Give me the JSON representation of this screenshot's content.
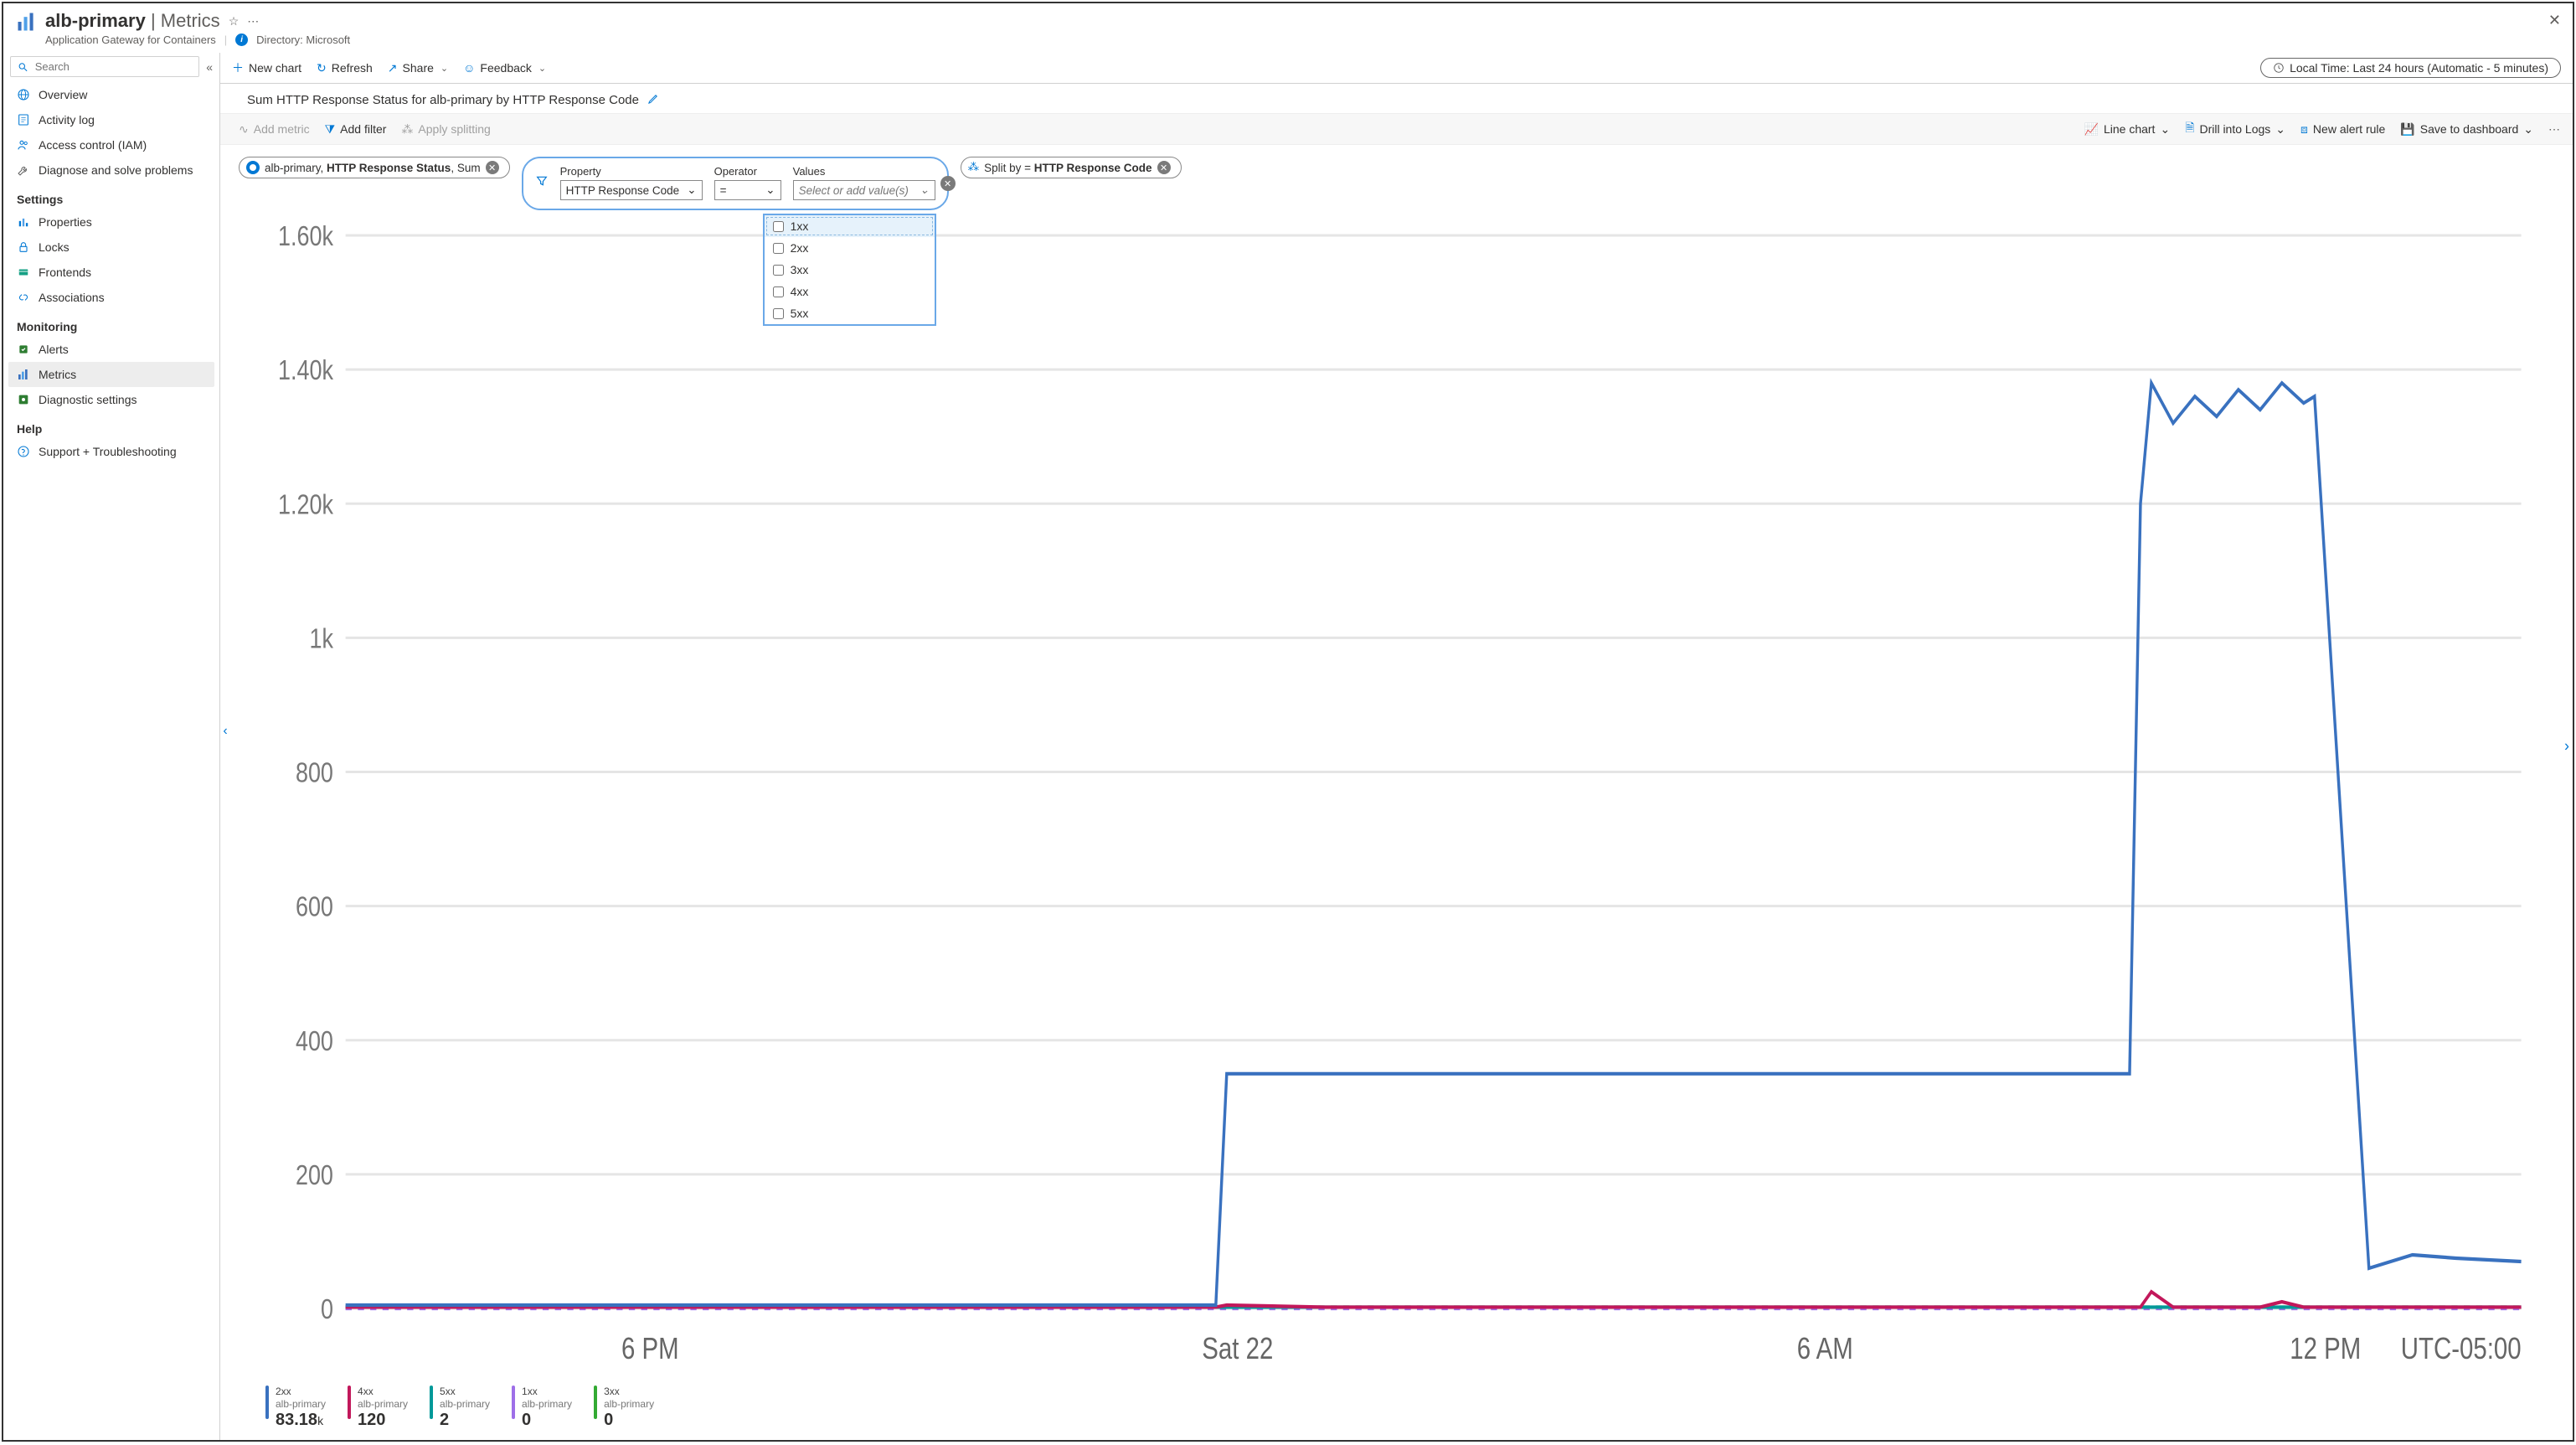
{
  "header": {
    "resource": "alb-primary",
    "page": "Metrics",
    "subtitle": "Application Gateway for Containers",
    "directory_label": "Directory:",
    "directory_value": "Microsoft"
  },
  "sidebar": {
    "search_placeholder": "Search",
    "groups": [
      {
        "heading": null,
        "items": [
          {
            "id": "overview",
            "label": "Overview",
            "icon": "globe"
          },
          {
            "id": "activity",
            "label": "Activity log",
            "icon": "log"
          },
          {
            "id": "iam",
            "label": "Access control (IAM)",
            "icon": "people"
          },
          {
            "id": "diag",
            "label": "Diagnose and solve problems",
            "icon": "wrench"
          }
        ]
      },
      {
        "heading": "Settings",
        "items": [
          {
            "id": "properties",
            "label": "Properties",
            "icon": "props"
          },
          {
            "id": "locks",
            "label": "Locks",
            "icon": "lock"
          },
          {
            "id": "frontends",
            "label": "Frontends",
            "icon": "card"
          },
          {
            "id": "associations",
            "label": "Associations",
            "icon": "link"
          }
        ]
      },
      {
        "heading": "Monitoring",
        "items": [
          {
            "id": "alerts",
            "label": "Alerts",
            "icon": "alert"
          },
          {
            "id": "metrics",
            "label": "Metrics",
            "icon": "metrics",
            "active": true
          },
          {
            "id": "diagset",
            "label": "Diagnostic settings",
            "icon": "diagset"
          }
        ]
      },
      {
        "heading": "Help",
        "items": [
          {
            "id": "support",
            "label": "Support + Troubleshooting",
            "icon": "help"
          }
        ]
      }
    ]
  },
  "toolbar": {
    "new_chart": "New chart",
    "refresh": "Refresh",
    "share": "Share",
    "feedback": "Feedback",
    "time_range": "Local Time: Last 24 hours (Automatic - 5 minutes)"
  },
  "chart": {
    "title": "Sum HTTP Response Status for alb-primary by HTTP Response Code",
    "toolbar": {
      "add_metric": "Add metric",
      "add_filter": "Add filter",
      "apply_splitting": "Apply splitting",
      "line_chart": "Line chart",
      "drill_logs": "Drill into Logs",
      "new_alert": "New alert rule",
      "save_dashboard": "Save to dashboard"
    },
    "metric_pill": {
      "resource": "alb-primary",
      "metric": "HTTP Response Status",
      "agg": "Sum"
    },
    "split_pill": {
      "prefix": "Split by =",
      "value": "HTTP Response Code"
    },
    "filter": {
      "property_label": "Property",
      "property_value": "HTTP Response Code",
      "operator_label": "Operator",
      "operator_value": "=",
      "values_label": "Values",
      "values_placeholder": "Select or add value(s)",
      "options": [
        "1xx",
        "2xx",
        "3xx",
        "4xx",
        "5xx"
      ]
    }
  },
  "chart_data": {
    "type": "line",
    "ylabel": "",
    "ylim": [
      0,
      1600
    ],
    "y_ticks": [
      "0",
      "200",
      "400",
      "600",
      "800",
      "1k",
      "1.20k",
      "1.40k",
      "1.60k"
    ],
    "x_ticks": [
      "6 PM",
      "Sat 22",
      "6 AM",
      "12 PM"
    ],
    "tz_label": "UTC-05:00",
    "x": [
      0,
      0.05,
      0.1,
      0.15,
      0.2,
      0.25,
      0.3,
      0.35,
      0.4,
      0.405,
      0.45,
      0.5,
      0.55,
      0.6,
      0.65,
      0.7,
      0.75,
      0.8,
      0.82,
      0.825,
      0.83,
      0.84,
      0.85,
      0.86,
      0.87,
      0.88,
      0.89,
      0.9,
      0.905,
      0.93,
      0.95,
      0.97,
      1.0
    ],
    "series": [
      {
        "name": "2xx",
        "color": "#3971bf",
        "values": [
          5,
          5,
          5,
          5,
          5,
          5,
          5,
          5,
          5,
          350,
          350,
          350,
          350,
          350,
          350,
          350,
          350,
          350,
          350,
          1200,
          1380,
          1320,
          1360,
          1330,
          1370,
          1340,
          1380,
          1350,
          1360,
          60,
          80,
          75,
          70
        ]
      },
      {
        "name": "4xx",
        "color": "#c2185b",
        "values": [
          2,
          2,
          2,
          2,
          2,
          2,
          2,
          2,
          2,
          5,
          2,
          2,
          2,
          2,
          2,
          2,
          2,
          2,
          2,
          2,
          25,
          2,
          2,
          2,
          2,
          2,
          10,
          2,
          2,
          2,
          2,
          2,
          2
        ]
      },
      {
        "name": "5xx",
        "color": "#009999",
        "values": [
          2,
          2,
          2,
          2,
          2,
          2,
          2,
          2,
          2,
          2,
          2,
          2,
          2,
          2,
          2,
          2,
          2,
          2,
          2,
          2,
          2,
          2,
          2,
          2,
          2,
          2,
          2,
          2,
          2,
          2,
          2,
          2,
          2
        ]
      },
      {
        "name": "1xx",
        "color": "#9e6fe8",
        "values": [
          0,
          0,
          0,
          0,
          0,
          0,
          0,
          0,
          0,
          0,
          0,
          0,
          0,
          0,
          0,
          0,
          0,
          0,
          0,
          0,
          0,
          0,
          0,
          0,
          0,
          0,
          0,
          0,
          0,
          0,
          0,
          0,
          0
        ]
      },
      {
        "name": "3xx",
        "color": "#33aa33",
        "values": [
          2,
          2,
          2,
          2,
          2,
          2,
          2,
          2,
          2,
          2,
          2,
          2,
          2,
          2,
          2,
          2,
          2,
          2,
          2,
          2,
          2,
          2,
          2,
          2,
          2,
          2,
          2,
          2,
          2,
          2,
          2,
          2,
          2
        ]
      }
    ]
  },
  "legend": [
    {
      "code": "2xx",
      "resource": "alb-primary",
      "value": "83.18",
      "unit": "k",
      "color": "#3971bf"
    },
    {
      "code": "4xx",
      "resource": "alb-primary",
      "value": "120",
      "unit": "",
      "color": "#c2185b"
    },
    {
      "code": "5xx",
      "resource": "alb-primary",
      "value": "2",
      "unit": "",
      "color": "#009999"
    },
    {
      "code": "1xx",
      "resource": "alb-primary",
      "value": "0",
      "unit": "",
      "color": "#9e6fe8"
    },
    {
      "code": "3xx",
      "resource": "alb-primary",
      "value": "0",
      "unit": "",
      "color": "#33aa33"
    }
  ]
}
